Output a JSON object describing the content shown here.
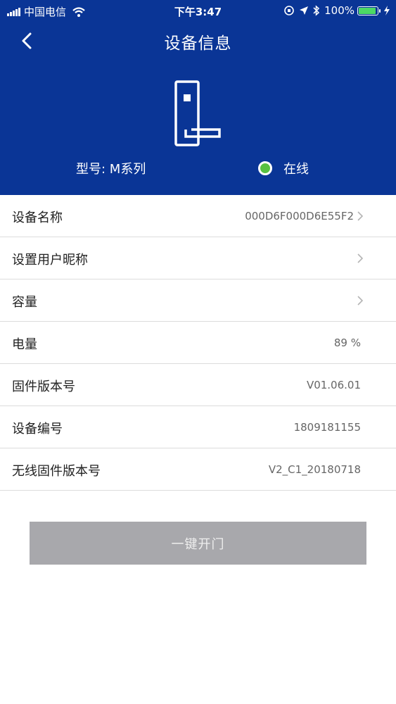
{
  "status_bar": {
    "carrier": "中国电信",
    "time": "下午3:47",
    "battery": "100%"
  },
  "nav": {
    "title": "设备信息"
  },
  "device": {
    "model": "型号: M系列",
    "status": "在线",
    "status_color": "#58c142"
  },
  "colors": {
    "header_bg": "#0a3596",
    "button_bg": "#a8a8ac"
  },
  "rows": [
    {
      "label": "设备名称",
      "value": "000D6F000D6E55F2",
      "has_arrow": true
    },
    {
      "label": "设置用户昵称",
      "value": "",
      "has_arrow": true
    },
    {
      "label": "容量",
      "value": "",
      "has_arrow": true
    },
    {
      "label": "电量",
      "value": "89 %",
      "has_arrow": false
    },
    {
      "label": "固件版本号",
      "value": "V01.06.01",
      "has_arrow": false
    },
    {
      "label": "设备编号",
      "value": "1809181155",
      "has_arrow": false
    },
    {
      "label": "无线固件版本号",
      "value": "V2_C1_20180718",
      "has_arrow": false
    }
  ],
  "actions": {
    "open_label": "一键开门"
  }
}
